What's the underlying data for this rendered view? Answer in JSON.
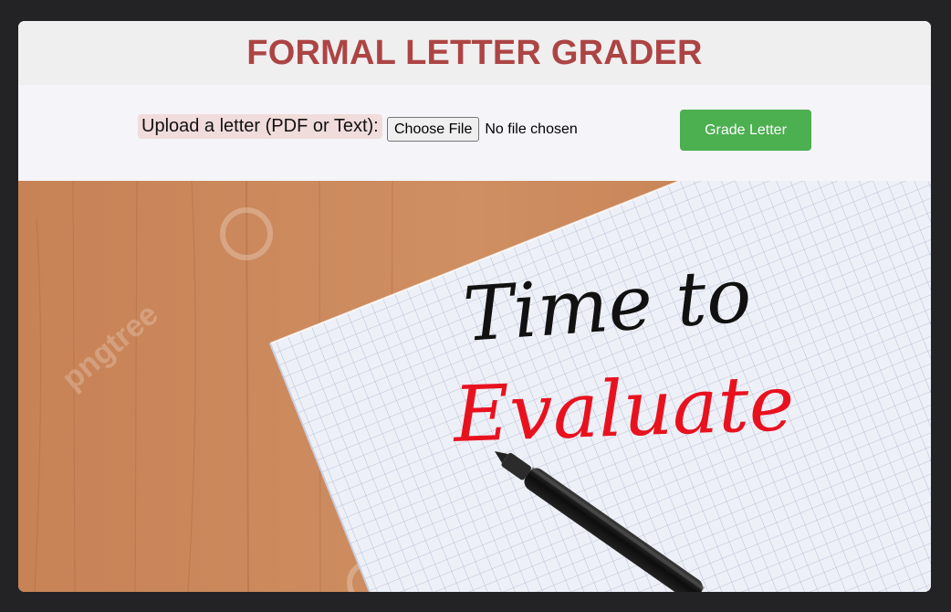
{
  "header": {
    "title": "FORMAL LETTER GRADER"
  },
  "upload": {
    "label": "Upload a letter (PDF or Text):",
    "choose_file_label": "Choose File",
    "file_status": "No file chosen",
    "submit_label": "Grade Letter"
  },
  "hero": {
    "line1": "Time to",
    "line2": "Evaluate",
    "watermark": "pngtree"
  },
  "colors": {
    "title": "#ad4444",
    "button": "#4caf50",
    "label_bg": "#f1dcdc",
    "wood": "#c98a5c",
    "ink_black": "#111111",
    "ink_red": "#e8121f"
  }
}
